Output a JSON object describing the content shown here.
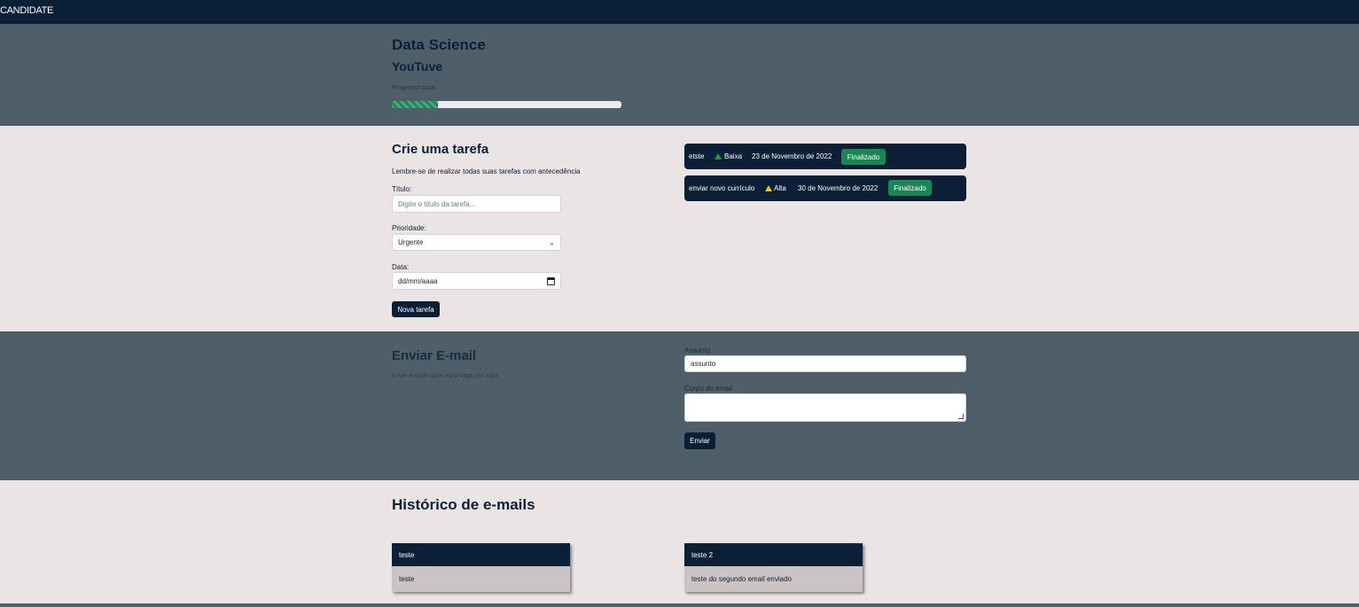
{
  "navbar": {
    "brand": "CANDIDATE"
  },
  "hero": {
    "title": "Data Science",
    "company": "YouTuve",
    "progress_label": "Progresso atual",
    "progress_value": 0.2
  },
  "tasks": {
    "form_title": "Crie uma tarefa",
    "form_hint": "Lembre-se de realizar todas suas tarefas com antecedência",
    "title_label": "Título:",
    "title_placeholder": "Digite o título da tarefa...",
    "priority_label": "Prioridade:",
    "priority_value": "Urgente",
    "date_label": "Data:",
    "date_placeholder": "dd/mm/aaaa",
    "submit_label": "Nova tarefa",
    "items": [
      {
        "name": "etste",
        "priority": "Baixa",
        "priority_color": "#1f9d3a",
        "date": "23 de Novembro de 2022",
        "status": "Finalizado"
      },
      {
        "name": "enviar novo currículo",
        "priority": "Alta",
        "priority_color": "#f6c400",
        "date": "30 de Novembro de 2022",
        "status": "Finalizado"
      }
    ]
  },
  "email": {
    "title": "Enviar E-mail",
    "subtitle": "Envie e-mails para essa vaga por aqui.",
    "subject_label": "Assunto",
    "subject_value": "assunto",
    "body_label": "Corpo do email",
    "send_label": "Enviar"
  },
  "history": {
    "title": "Histórico de e-mails",
    "items": [
      {
        "subject": "teste",
        "body": "teste"
      },
      {
        "subject": "teste 2",
        "body": "teste do segundo email enviado"
      }
    ]
  },
  "colors": {
    "navy": "#0b1f37",
    "slate": "#4e5f6a",
    "success": "#198754",
    "background": "#ebe4e4"
  }
}
